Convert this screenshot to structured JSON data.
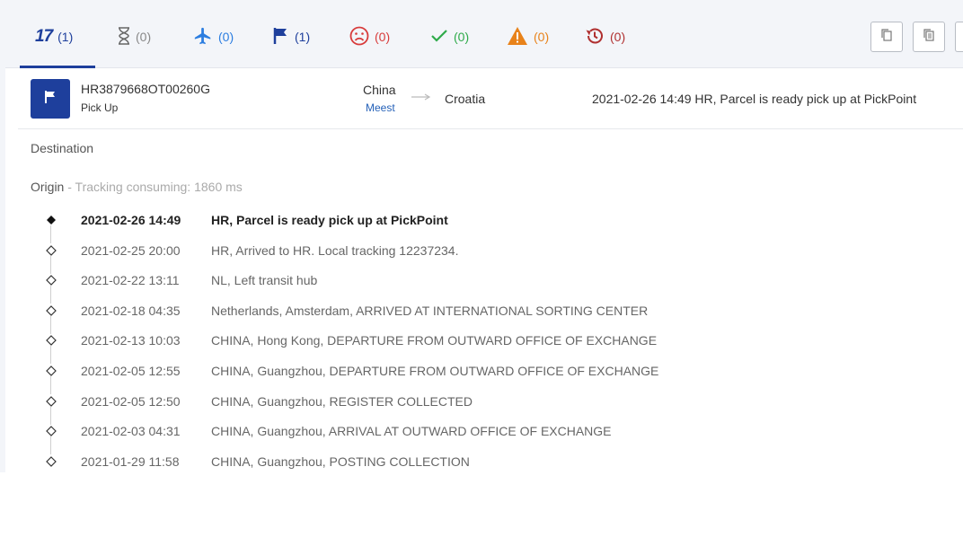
{
  "tabs": [
    {
      "name": "17track",
      "label": "17",
      "count": "(1)",
      "color": "#1e3f9c"
    },
    {
      "name": "pending",
      "icon": "hourglass-icon",
      "count": "(0)",
      "color": "#666666"
    },
    {
      "name": "in-transit",
      "icon": "airplane-icon",
      "count": "(0)",
      "color": "#2b7de0"
    },
    {
      "name": "delivered-flag",
      "icon": "flag-icon",
      "count": "(1)",
      "color": "#1e3f9c"
    },
    {
      "name": "exception",
      "icon": "sad-face-icon",
      "count": "(0)",
      "color": "#d83b3b"
    },
    {
      "name": "delivered",
      "icon": "check-icon",
      "count": "(0)",
      "color": "#2eaa4a"
    },
    {
      "name": "alert",
      "icon": "warning-icon",
      "count": "(0)",
      "color": "#e8821a"
    },
    {
      "name": "expired",
      "icon": "history-icon",
      "count": "(0)",
      "color": "#b03030"
    }
  ],
  "parcel": {
    "tracking_number": "HR3879668OT00260G",
    "status": "Pick Up",
    "origin_country": "China",
    "carrier": "Meest",
    "destination_country": "Croatia",
    "latest_event": "2021-02-26 14:49  HR, Parcel is ready pick up at PickPoint"
  },
  "sections": {
    "destination_label": "Destination",
    "origin_label": "Origin",
    "origin_note": " - Tracking consuming: 1860 ms"
  },
  "events": [
    {
      "time": "2021-02-26 14:49",
      "desc": "HR, Parcel is ready pick up at PickPoint"
    },
    {
      "time": "2021-02-25 20:00",
      "desc": "HR, Arrived to HR. Local tracking 12237234."
    },
    {
      "time": "2021-02-22 13:11",
      "desc": "NL, Left transit hub"
    },
    {
      "time": "2021-02-18 04:35",
      "desc": "Netherlands, Amsterdam, ARRIVED AT INTERNATIONAL SORTING CENTER"
    },
    {
      "time": "2021-02-13 10:03",
      "desc": "CHINA, Hong Kong, DEPARTURE FROM OUTWARD OFFICE OF EXCHANGE"
    },
    {
      "time": "2021-02-05 12:55",
      "desc": "CHINA, Guangzhou, DEPARTURE FROM OUTWARD OFFICE OF EXCHANGE"
    },
    {
      "time": "2021-02-05 12:50",
      "desc": "CHINA, Guangzhou, REGISTER COLLECTED"
    },
    {
      "time": "2021-02-03 04:31",
      "desc": "CHINA, Guangzhou, ARRIVAL AT OUTWARD OFFICE OF EXCHANGE"
    },
    {
      "time": "2021-01-29 11:58",
      "desc": "CHINA, Guangzhou, POSTING COLLECTION"
    }
  ]
}
